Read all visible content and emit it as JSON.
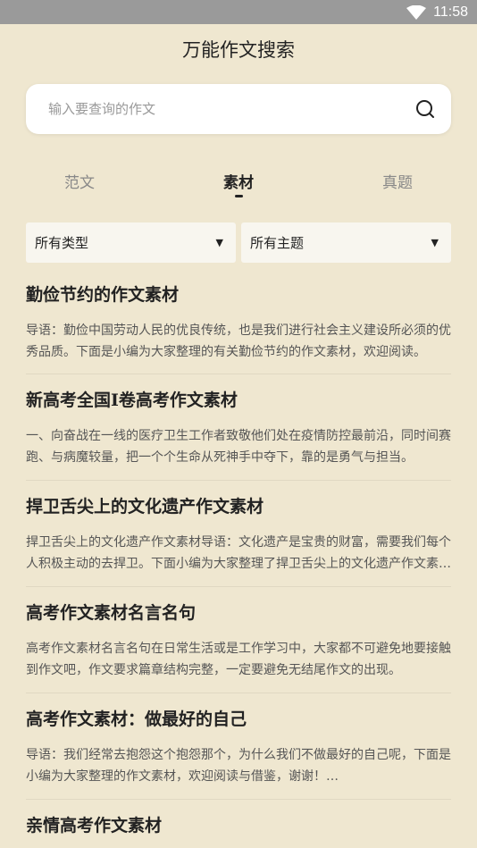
{
  "status": {
    "time": "11:58"
  },
  "app": {
    "title": "万能作文搜索"
  },
  "search": {
    "placeholder": "输入要查询的作文"
  },
  "tabs": [
    {
      "label": "范文",
      "active": false
    },
    {
      "label": "素材",
      "active": true
    },
    {
      "label": "真题",
      "active": false
    }
  ],
  "filters": {
    "type": "所有类型",
    "theme": "所有主题"
  },
  "articles": [
    {
      "title": "勤俭节约的作文素材",
      "excerpt": "导语：勤俭中国劳动人民的优良传统，也是我们进行社会主义建设所必须的优秀品质。下面是小编为大家整理的有关勤俭节约的作文素材，欢迎阅读。"
    },
    {
      "title": "新高考全国I卷高考作文素材",
      "excerpt": "一、向奋战在一线的医疗卫生工作者致敬他们处在疫情防控最前沿，同时间赛跑、与病魔较量，把一个个生命从死神手中夺下，靠的是勇气与担当。"
    },
    {
      "title": "捍卫舌尖上的文化遗产作文素材",
      "excerpt": "捍卫舌尖上的文化遗产作文素材导语：文化遗产是宝贵的财富，需要我们每个人积极主动的去捍卫。下面小编为大家整理了捍卫舌尖上的文化遗产作文素材。"
    },
    {
      "title": "高考作文素材名言名句",
      "excerpt": "高考作文素材名言名句在日常生活或是工作学习中，大家都不可避免地要接触到作文吧，作文要求篇章结构完整，一定要避免无结尾作文的出现。"
    },
    {
      "title": "高考作文素材：做最好的自己",
      "excerpt": "导语：我们经常去抱怨这个抱怨那个，为什么我们不做最好的自己呢，下面是小编为大家整理的作文素材，欢迎阅读与借鉴，谢谢！…"
    },
    {
      "title": "亲情高考作文素材",
      "excerpt": ""
    }
  ]
}
